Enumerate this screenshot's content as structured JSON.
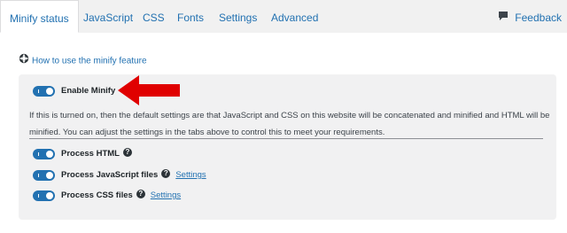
{
  "tabs": [
    {
      "label": "Minify status",
      "active": true
    },
    {
      "label": "JavaScript",
      "active": false
    },
    {
      "label": "CSS",
      "active": false
    },
    {
      "label": "Fonts",
      "active": false
    },
    {
      "label": "Settings",
      "active": false
    },
    {
      "label": "Advanced",
      "active": false
    }
  ],
  "feedback": {
    "label": "Feedback",
    "icon": "chat-bubble-icon"
  },
  "howto": {
    "label": "How to use the minify feature",
    "icon": "lifebuoy-icon"
  },
  "enable_minify": {
    "label": "Enable Minify",
    "enabled": true,
    "description": "If this is turned on, then the default settings are that JavaScript and CSS on this website will be concatenated and minified and HTML will be minified. You can adjust the settings in the tabs above to control this to meet your requirements."
  },
  "options": [
    {
      "label": "Process HTML",
      "enabled": true,
      "help": "?",
      "link": ""
    },
    {
      "label": "Process JavaScript files",
      "enabled": true,
      "help": "?",
      "link": "Settings"
    },
    {
      "label": "Process CSS files",
      "enabled": true,
      "help": "?",
      "link": "Settings"
    }
  ],
  "colors": {
    "accent": "#2271b1",
    "arrow": "#e00000"
  }
}
